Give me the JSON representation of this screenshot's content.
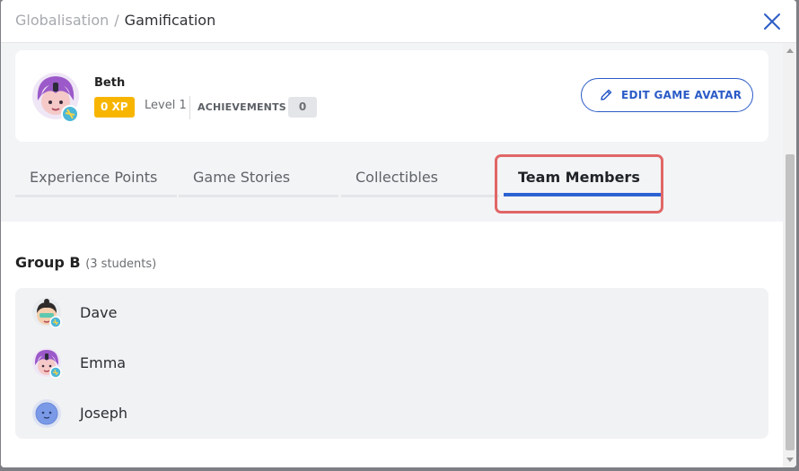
{
  "header": {
    "breadcrumb": [
      "Globalisation",
      "Gamification"
    ],
    "separator": "/"
  },
  "profile": {
    "name": "Beth",
    "xp": "0 XP",
    "level": "Level 1",
    "achievements_label": "ACHIEVEMENTS",
    "achievements_count": "0",
    "edit_button": "EDIT GAME AVATAR",
    "avatar_icon": "purple-hair-avatar-icon"
  },
  "tabs": [
    {
      "label": "Experience Points",
      "active": false
    },
    {
      "label": "Game Stories",
      "active": false
    },
    {
      "label": "Collectibles",
      "active": false
    },
    {
      "label": "Team Members",
      "active": true
    }
  ],
  "group": {
    "title": "Group B",
    "count": "(3 students)",
    "members": [
      {
        "name": "Dave",
        "avatar_icon": "dark-hair-avatar-icon"
      },
      {
        "name": "Emma",
        "avatar_icon": "purple-hair-avatar-icon"
      },
      {
        "name": "Joseph",
        "avatar_icon": "blue-face-avatar-icon"
      }
    ]
  },
  "colors": {
    "accent": "#2c62d2",
    "xp_badge": "#f7b500",
    "highlight": "#e06666"
  }
}
